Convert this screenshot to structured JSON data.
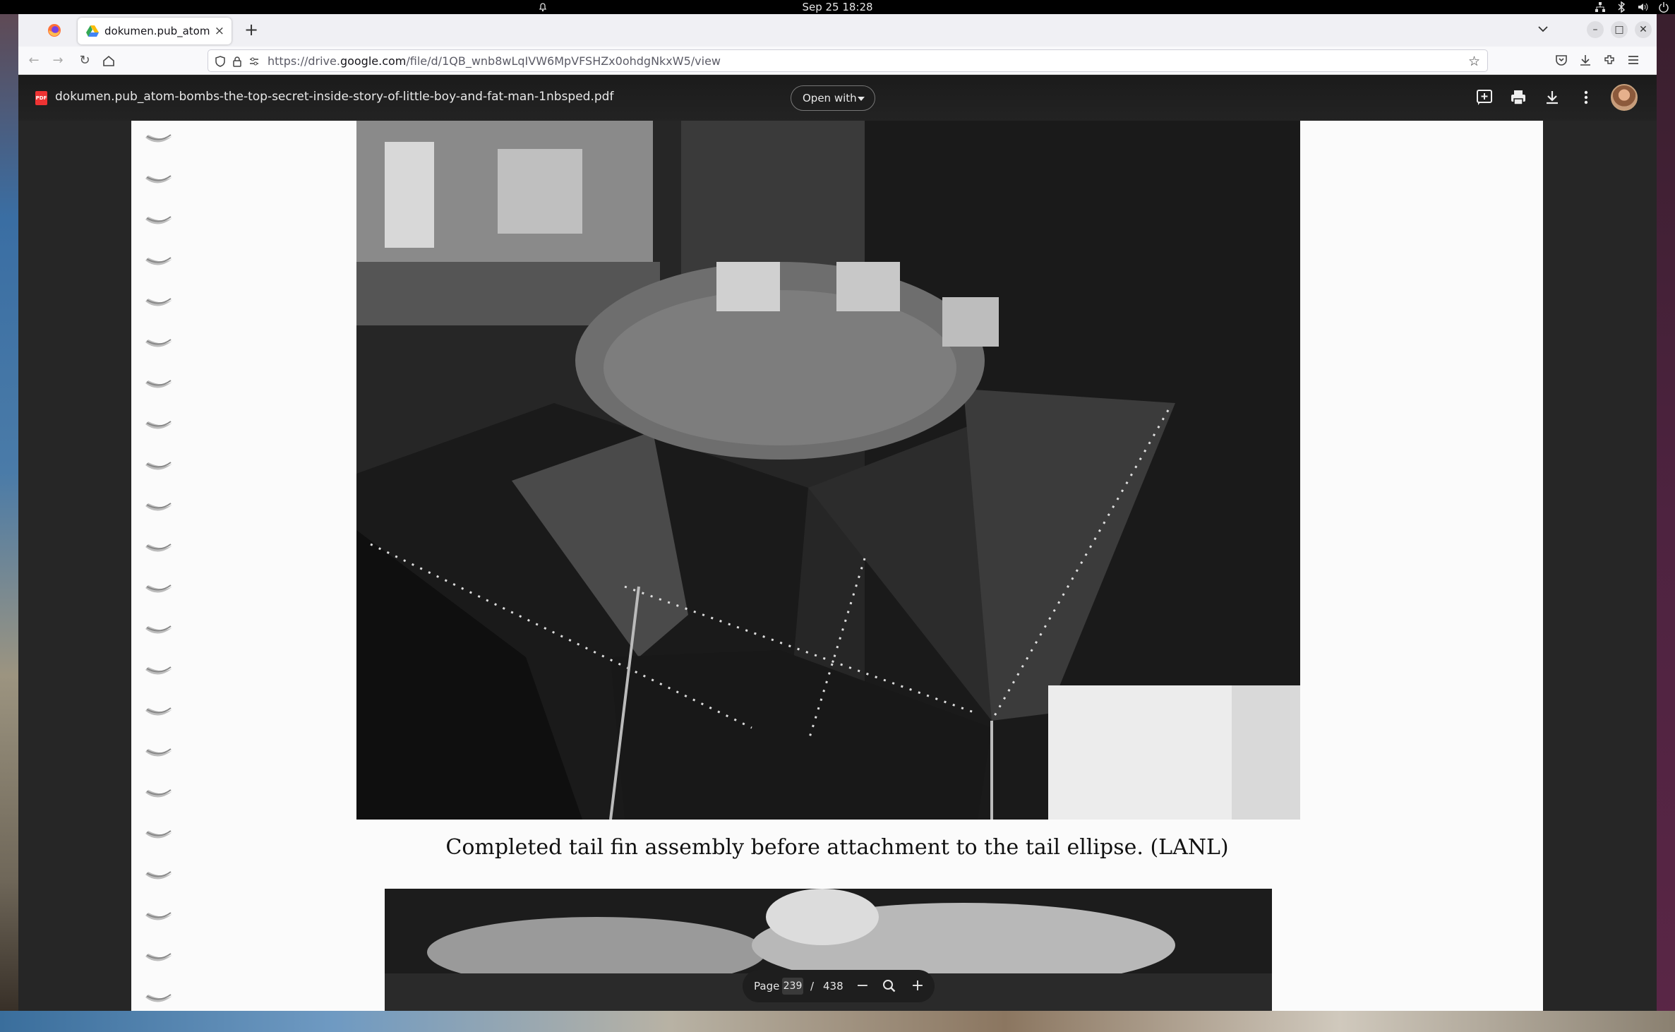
{
  "os": {
    "clock": "Sep 25  18:28"
  },
  "browser": {
    "tab": {
      "title": "dokumen.pub_atom-bom",
      "close": "×"
    },
    "new_tab": "+",
    "url_host_prefix": "https://drive.",
    "url_host": "google.com",
    "url_path": "/file/d/1QB_wnb8wLqIVW6MpVFSHZx0ohdgNkxW5/view"
  },
  "viewer": {
    "file_icon": "PDF",
    "file_name": "dokumen.pub_atom-bombs-the-top-secret-inside-story-of-little-boy-and-fat-man-1nbsped.pdf",
    "open_with_label": "Open with",
    "caption": "Completed tail fin assembly before attachment to the tail ellipse.  (LANL)",
    "page_label": "Page",
    "current_page": "239",
    "page_separator": "/",
    "total_pages": "438"
  },
  "icons": [
    "firefox-icon",
    "drive-icon",
    "back-icon",
    "forward-icon",
    "reload-icon",
    "home-icon",
    "shield-icon",
    "lock-icon",
    "star-icon",
    "pocket-icon",
    "download-icon",
    "extensions-icon",
    "menu-icon",
    "add-comment-icon",
    "print-icon",
    "more-icon",
    "zoom-out-icon",
    "zoom-icon",
    "zoom-in-icon"
  ],
  "colors": {
    "viewer_bg": "#262626",
    "page_bg": "#fbfbfb",
    "pdf_red": "#e33333"
  }
}
